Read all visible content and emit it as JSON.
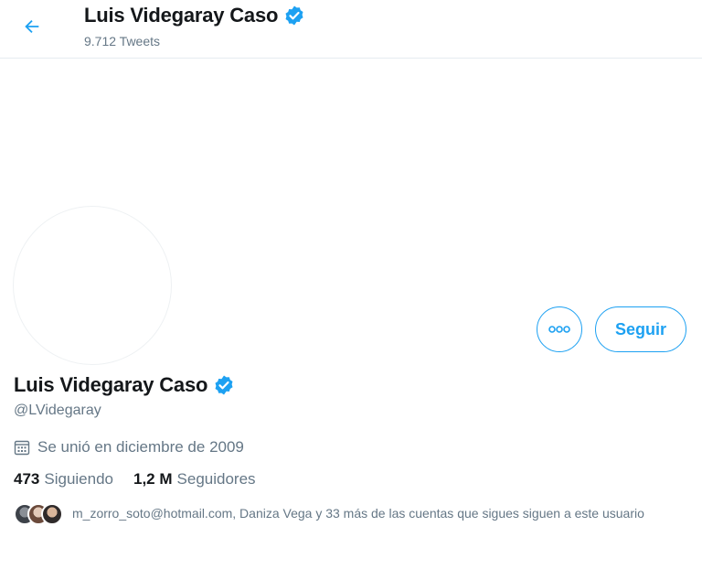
{
  "header": {
    "name": "Luis Videgaray Caso",
    "tweet_count": "9.712 Tweets"
  },
  "actions": {
    "follow_label": "Seguir"
  },
  "profile": {
    "name": "Luis Videgaray Caso",
    "handle": "@LVidegaray",
    "joined": "Se unió en diciembre de 2009",
    "following_count": "473",
    "following_label": "Siguiendo",
    "followers_count": "1,2 M",
    "followers_label": "Seguidores",
    "followed_by_text": "m_zorro_soto@hotmail.com, Daniza Vega y 33 más de las cuentas que sigues siguen a este usuario"
  },
  "colors": {
    "accent": "#1da1f2",
    "secondary_text": "#657786"
  },
  "icons": {
    "back": "arrow-left-icon",
    "verified": "verified-badge-icon",
    "more": "more-dots-icon",
    "calendar": "calendar-icon"
  }
}
